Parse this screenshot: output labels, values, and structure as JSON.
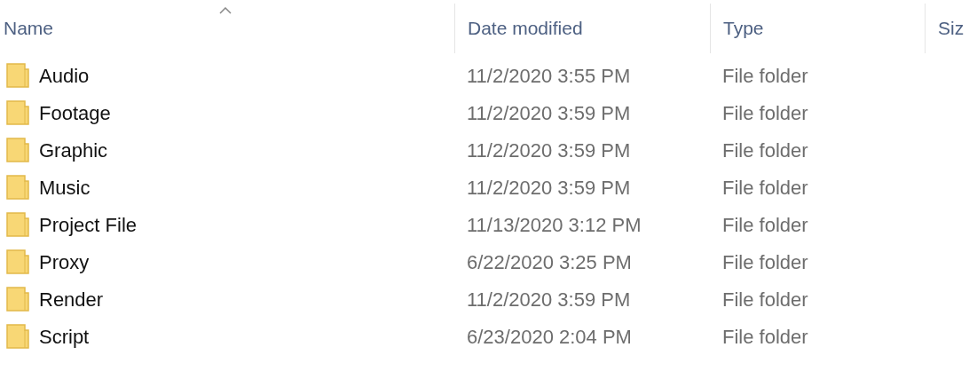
{
  "columns": [
    {
      "label": "Name",
      "sorted": true
    },
    {
      "label": "Date modified",
      "sorted": false
    },
    {
      "label": "Type",
      "sorted": false
    },
    {
      "label": "Siz",
      "sorted": false
    }
  ],
  "rows": [
    {
      "name": "Audio",
      "date": "11/2/2020 3:55 PM",
      "type": "File folder"
    },
    {
      "name": "Footage",
      "date": "11/2/2020 3:59 PM",
      "type": "File folder"
    },
    {
      "name": "Graphic",
      "date": "11/2/2020 3:59 PM",
      "type": "File folder"
    },
    {
      "name": "Music",
      "date": "11/2/2020 3:59 PM",
      "type": "File folder"
    },
    {
      "name": "Project File",
      "date": "11/13/2020 3:12 PM",
      "type": "File folder"
    },
    {
      "name": "Proxy",
      "date": "6/22/2020 3:25 PM",
      "type": "File folder"
    },
    {
      "name": "Render",
      "date": "11/2/2020 3:59 PM",
      "type": "File folder"
    },
    {
      "name": "Script",
      "date": "6/23/2020 2:04 PM",
      "type": "File folder"
    }
  ]
}
